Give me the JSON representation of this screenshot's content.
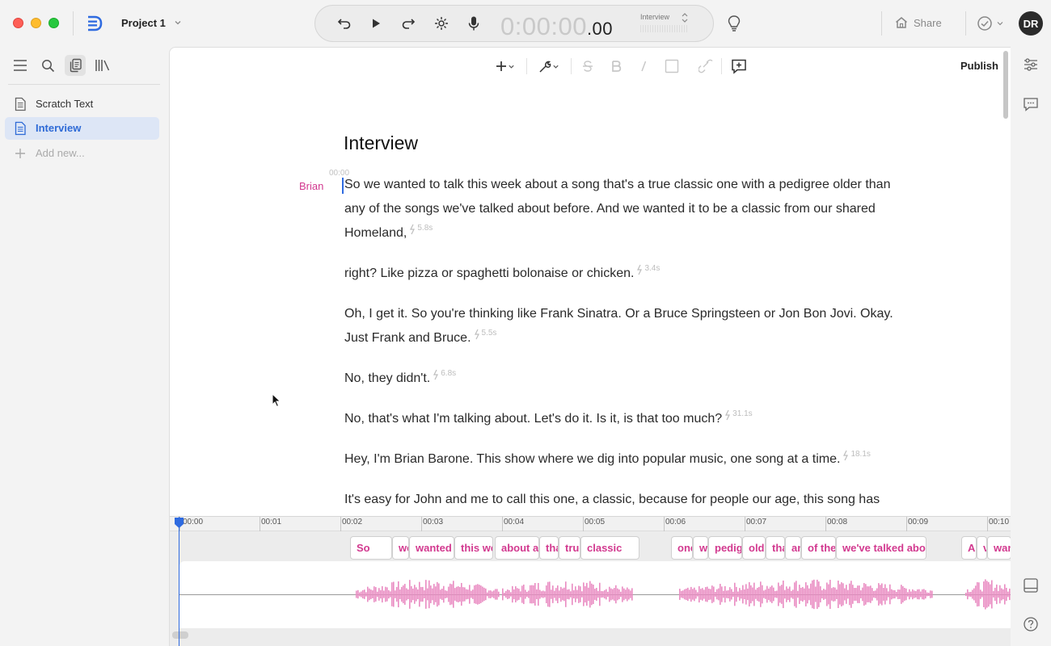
{
  "window": {
    "project_name": "Project 1"
  },
  "transport": {
    "timecode_main": "0:00:00",
    "timecode_fraction": ".00",
    "track_name": "Interview"
  },
  "header": {
    "share_label": "Share",
    "avatar_initials": "DR"
  },
  "sidebar": {
    "documents": [
      {
        "label": "Scratch Text",
        "selected": false
      },
      {
        "label": "Interview",
        "selected": true
      }
    ],
    "add_new_label": "Add new..."
  },
  "toolbar": {
    "publish_label": "Publish"
  },
  "document": {
    "title": "Interview",
    "start_timestamp": "00:00",
    "speaker": "Brian",
    "paragraphs": [
      {
        "text": "So we wanted to talk this week about a song that's a true classic one with a pedigree older than any of the songs we've talked about before. And we wanted it to be a classic from our shared Homeland,",
        "pause": "5.8s"
      },
      {
        "text": "right? Like pizza or spaghetti bolonaise or chicken.",
        "pause": "3.4s"
      },
      {
        "text": "Oh, I get it. So you're thinking like Frank Sinatra. Or a Bruce Springsteen or Jon Bon Jovi. Okay. Just Frank and Bruce.",
        "pause": "5.5s"
      },
      {
        "text": "No, they didn't.",
        "pause": "6.8s"
      },
      {
        "text": "No, that's what I'm talking about. Let's do it. Is it, is that too much?",
        "pause": "31.1s"
      },
      {
        "text": "Hey, I'm Brian Barone. This show where we dig into popular music, one song at a time.",
        "pause": "18.1s"
      },
      {
        "text": "It's easy for John and me to call this one, a classic, because for people our age, this song has",
        "pause": ""
      }
    ]
  },
  "timeline": {
    "ticks": [
      "00:00",
      "00:01",
      "00:02",
      "00:03",
      "00:04",
      "00:05",
      "00:06",
      "00:07",
      "00:08",
      "00:09",
      "00:10"
    ],
    "words": [
      "So",
      "we",
      "wanted",
      "this we",
      "about a",
      "that",
      "true",
      "classic",
      "one",
      "w",
      "pedigree",
      "older",
      "than",
      "any",
      "of the",
      "we've talked about",
      "A",
      "v",
      "wanted"
    ]
  },
  "colors": {
    "accent": "#2f6be0",
    "speaker": "#d2398f",
    "waveform": "#e98bc2"
  },
  "icons": [
    "app-logo-icon",
    "undo-icon",
    "play-icon",
    "redo-icon",
    "magic-icon",
    "microphone-icon",
    "bulb-icon",
    "home-icon",
    "check-circle-icon",
    "menu-icon",
    "search-icon",
    "documents-icon",
    "library-icon",
    "document-icon",
    "plus-icon",
    "wrench-icon",
    "strikethrough-icon",
    "bold-icon",
    "italic-icon",
    "highlight-icon",
    "link-icon",
    "comment-add-icon",
    "properties-icon",
    "comments-icon",
    "panel-icon",
    "help-icon"
  ]
}
